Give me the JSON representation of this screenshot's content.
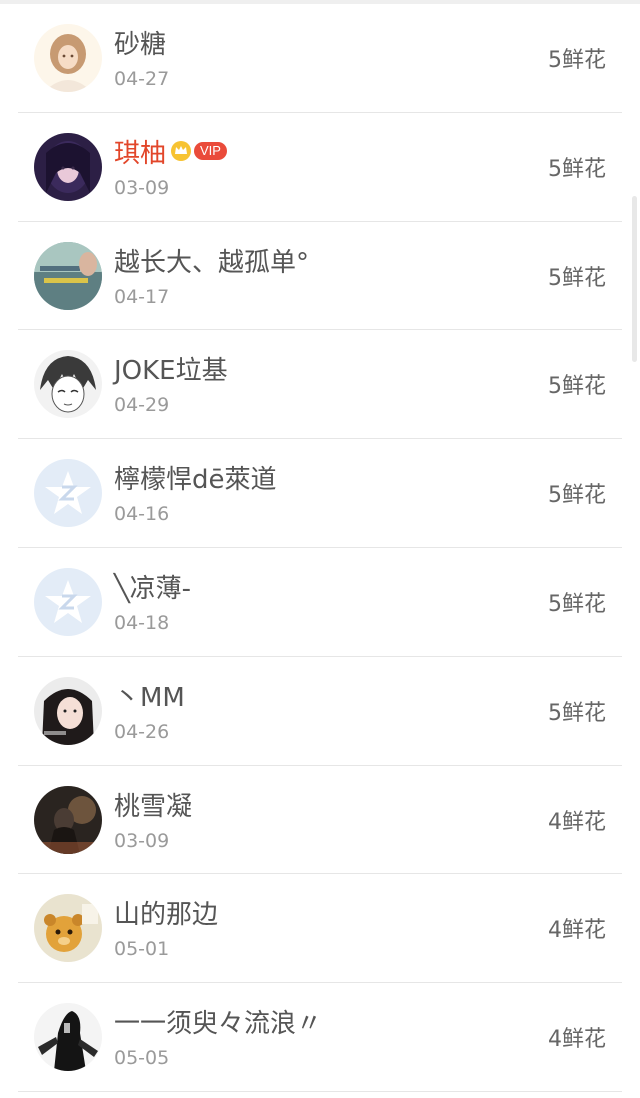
{
  "list": {
    "items": [
      {
        "name": "砂糖",
        "date": "04-27",
        "flowers": "5鲜花",
        "avatar": "avatar-girl-portrait"
      },
      {
        "name": "琪柚",
        "date": "03-09",
        "flowers": "5鲜花",
        "avatar": "avatar-purple-girl",
        "vip_label": "VIP"
      },
      {
        "name": "越长大、越孤单°",
        "date": "04-17",
        "flowers": "5鲜花",
        "avatar": "avatar-text-photo"
      },
      {
        "name": "JOKE垃基",
        "date": "04-29",
        "flowers": "5鲜花",
        "avatar": "avatar-anime-sketch"
      },
      {
        "name": "檸檬悍dē萊道",
        "date": "04-16",
        "flowers": "5鲜花",
        "avatar": "avatar-default-qq"
      },
      {
        "name": "╲凉薄-",
        "date": "04-18",
        "flowers": "5鲜花",
        "avatar": "avatar-default-qq"
      },
      {
        "name": "丶MM",
        "date": "04-26",
        "flowers": "5鲜花",
        "avatar": "avatar-girl-dark-hair"
      },
      {
        "name": "桃雪凝",
        "date": "03-09",
        "flowers": "4鲜花",
        "avatar": "avatar-dark-scene"
      },
      {
        "name": "山的那边",
        "date": "05-01",
        "flowers": "4鲜花",
        "avatar": "avatar-cartoon-bear"
      },
      {
        "name": "一一须臾々流浪〃",
        "date": "05-05",
        "flowers": "4鲜花",
        "avatar": "avatar-bw-figure"
      }
    ]
  },
  "colors": {
    "vip_name": "#e2462a",
    "vip_badge": "#ea4b3a",
    "name_text": "#555555",
    "date_text": "#9a9a9a"
  }
}
